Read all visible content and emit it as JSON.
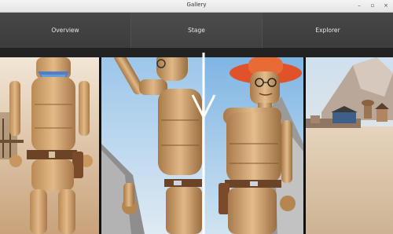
{
  "window": {
    "title": "Gallery",
    "controls": [
      "–",
      "▫",
      "×"
    ]
  },
  "tabs": [
    {
      "label": "Overview",
      "active": false
    },
    {
      "label": "Stage",
      "active": true
    },
    {
      "label": "Explorer",
      "active": false
    }
  ],
  "gallery": {
    "images": [
      {
        "name": "cowboy-puppet-scarf"
      },
      {
        "name": "cowboy-puppet-waving"
      },
      {
        "name": "cowboy-puppet-hat-glasses"
      },
      {
        "name": "western-town-landscape"
      }
    ]
  },
  "colors": {
    "tabbar": "#3a3a3a",
    "arrow": "#ffffff"
  }
}
